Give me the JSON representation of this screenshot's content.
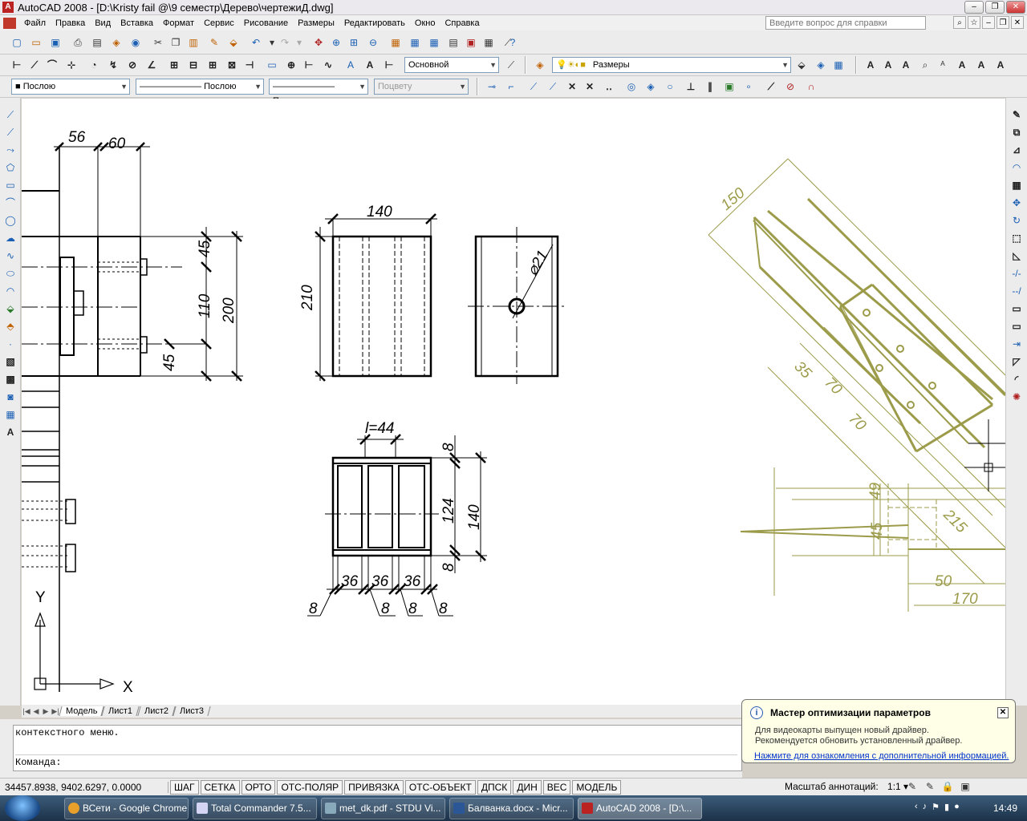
{
  "window": {
    "title": "AutoCAD 2008 - [D:\\Kristy fail @\\9 семестр\\Дерево\\чертежиД.dwg]"
  },
  "menu": {
    "items": [
      "Файл",
      "Правка",
      "Вид",
      "Вставка",
      "Формат",
      "Сервис",
      "Рисование",
      "Размеры",
      "Редактировать",
      "Окно",
      "Справка"
    ],
    "help_placeholder": "Введите вопрос для справки"
  },
  "toolbars": {
    "text_style": "Основной",
    "dim_style": "Размеры",
    "color": "Послою",
    "linetype": "Послою",
    "lineweight": "Послою",
    "plotstyle": "Поцвету"
  },
  "drawing": {
    "left_view": {
      "dims": [
        "56",
        "60",
        "45",
        "110",
        "200",
        "45"
      ]
    },
    "front_view": {
      "width": "140",
      "height": "210"
    },
    "side_view": {
      "hole": "⌀21"
    },
    "section_view": {
      "spacing": "l=44",
      "dims_right": [
        "8",
        "124",
        "140",
        "8"
      ],
      "dims_bottom": [
        "36",
        "36",
        "36"
      ],
      "dims_eight": [
        "8",
        "8",
        "8",
        "8"
      ]
    },
    "node_view": {
      "dims": [
        "150",
        "35",
        "70",
        "70",
        "49",
        "45",
        "215",
        "50",
        "170"
      ]
    },
    "ucs": {
      "y_label": "Y",
      "x_label": "X"
    }
  },
  "layout_tabs": [
    "Модель",
    "Лист1",
    "Лист2",
    "Лист3"
  ],
  "command": {
    "history": "контекстного меню.",
    "prompt": "Команда:"
  },
  "status": {
    "coords": "34457.8938, 9402.6297, 0.0000",
    "modes": [
      "ШАГ",
      "СЕТКА",
      "ОРТО",
      "ОТС-ПОЛЯР",
      "ПРИВЯЗКА",
      "ОТС-ОБЪЕКТ",
      "ДПСК",
      "ДИН",
      "ВЕС",
      "МОДЕЛЬ"
    ],
    "annotation_scale_label": "Масштаб аннотаций:",
    "annotation_scale_value": "1:1"
  },
  "balloon": {
    "title": "Мастер оптимизации параметров",
    "line1": "Для видеокарты выпущен новый драйвер.",
    "line2": "Рекомендуется обновить установленный драйвер.",
    "link": "Нажмите для ознакомления с дополнительной информацией."
  },
  "taskbar": {
    "tasks": [
      "ВСети - Google Chrome",
      "Total Commander 7.5...",
      "met_dk.pdf - STDU Vi...",
      "Балванка.docx - Micr...",
      "AutoCAD 2008 - [D:\\..."
    ],
    "clock": "14:49"
  },
  "colors": {
    "drawing_black": "#000000",
    "drawing_olive": "#9b9b4a"
  }
}
